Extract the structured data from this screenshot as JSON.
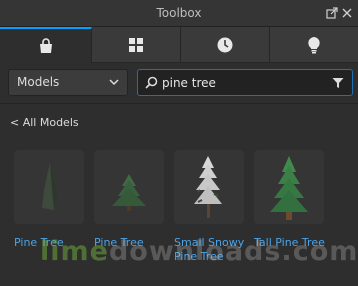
{
  "window": {
    "title": "Toolbox"
  },
  "tabs": [
    {
      "id": "marketplace",
      "icon": "shopping-bag-icon",
      "active": true
    },
    {
      "id": "inventory",
      "icon": "grid-icon",
      "active": false
    },
    {
      "id": "recent",
      "icon": "clock-icon",
      "active": false
    },
    {
      "id": "creations",
      "icon": "lightbulb-icon",
      "active": false
    }
  ],
  "category_dropdown": {
    "selected": "Models"
  },
  "search": {
    "value": "pine tree"
  },
  "back_link": {
    "label": "< All Models"
  },
  "results": [
    {
      "name": "Pine Tree"
    },
    {
      "name": "Pine Tree"
    },
    {
      "name": "Small Snowy Pine Tree"
    },
    {
      "name": "Tall Pine Tree"
    }
  ],
  "watermark": {
    "part1": "lime",
    "part2": "downloads.com"
  },
  "colors": {
    "accent": "#00a2ff",
    "link": "#4da3e6",
    "background": "#2e2e2e"
  }
}
